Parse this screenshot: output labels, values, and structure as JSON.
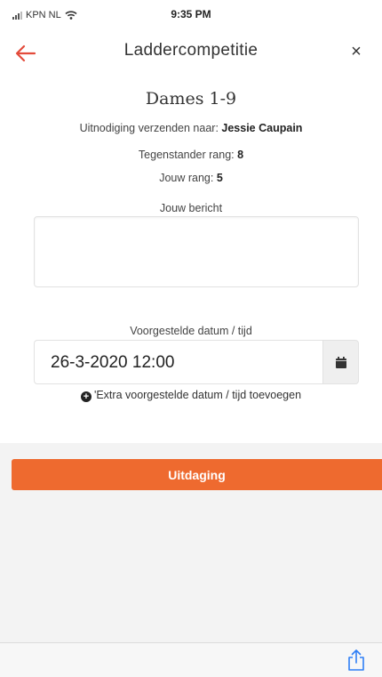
{
  "status_bar": {
    "carrier": "KPN NL",
    "time": "9:35 PM"
  },
  "nav": {
    "title": "Laddercompetitie",
    "close_label": "×",
    "back_icon": "arrow-left-icon"
  },
  "challenge": {
    "group": "Dames 1-9",
    "invite_prefix": "Uitnodiging verzenden naar:",
    "opponent_name": "Jessie Caupain",
    "opponent_rank_label": "Tegenstander rang:",
    "opponent_rank": "8",
    "own_rank_label": "Jouw rang:",
    "own_rank": "5",
    "message_label": "Jouw bericht",
    "message_value": "",
    "date_label": "Voorgestelde datum / tijd",
    "date_value": "26-3-2020 12:00",
    "extra_date_link": "'Extra voorgestelde datum / tijd toevoegen",
    "submit_label": "Uitdaging"
  },
  "colors": {
    "accent": "#ee6a2f",
    "back_arrow": "#e34b3b",
    "share_icon": "#2f7ff6"
  }
}
